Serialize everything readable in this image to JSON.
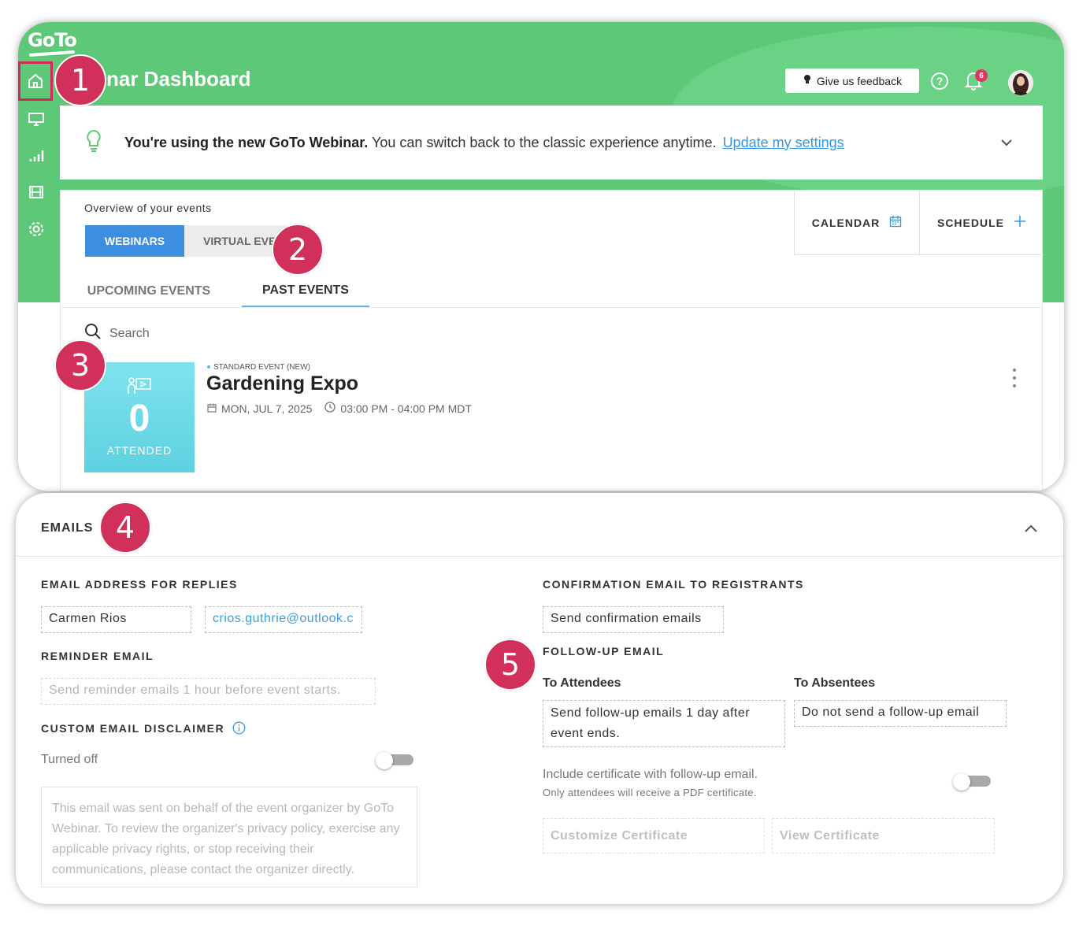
{
  "app": {
    "logo_text": "GoTo",
    "page_title": "nar Dashboard"
  },
  "header": {
    "feedback_label": "Give us feedback",
    "notification_count": "6"
  },
  "banner": {
    "bold_text": "You're using the new GoTo Webinar.",
    "text": " You can switch back to the classic experience anytime.",
    "link_text": "Update my settings"
  },
  "overview": {
    "label": "Overview of your events",
    "segments": [
      "WEBINARS",
      "VIRTUAL EVENTS"
    ],
    "calendar_label": "CALENDAR",
    "schedule_label": "SCHEDULE",
    "tabs": [
      "UPCOMING EVENTS",
      "PAST EVENTS"
    ],
    "search_placeholder": "Search"
  },
  "event": {
    "type": "STANDARD EVENT (NEW)",
    "title": "Gardening Expo",
    "date": "MON, JUL 7, 2025",
    "time": "03:00 PM - 04:00 PM MDT",
    "attended_count": "0",
    "attended_label": "ATTENDED"
  },
  "emails": {
    "header": "EMAILS",
    "reply_label": "EMAIL ADDRESS FOR REPLIES",
    "reply_name": "Carmen Rios",
    "reply_email": "crios.guthrie@outlook.c",
    "reminder_label": "REMINDER EMAIL",
    "reminder_value": "Send reminder emails 1 hour before event starts.",
    "disclaimer_label": "CUSTOM EMAIL DISCLAIMER",
    "disclaimer_state": "Turned off",
    "disclaimer_text": "This email was sent on behalf of the event organizer by GoTo Webinar. To review the organizer's privacy policy, exercise any applicable privacy rights, or stop receiving their communications, please contact the organizer directly.",
    "confirmation_label": "CONFIRMATION EMAIL TO REGISTRANTS",
    "confirmation_value": "Send confirmation emails",
    "followup_label": "FOLLOW-UP EMAIL",
    "attendees_label": "To Attendees",
    "attendees_value_line1": "Send follow-up emails 1 day after",
    "attendees_value_line2": "event ends.",
    "absentees_label": "To Absentees",
    "absentees_value": "Do not send a follow-up email",
    "certificate_label": "Include certificate with follow-up email.",
    "certificate_note": "Only attendees will receive a PDF certificate.",
    "customize_cert_label": "Customize Certificate",
    "view_cert_label": "View Certificate"
  },
  "callouts": [
    "1",
    "2",
    "3",
    "4",
    "5"
  ],
  "colors": {
    "brand_green": "#5cc878",
    "accent_blue": "#3c8fe0",
    "callout_red": "#d0305a",
    "attend_tile": "#6edae8"
  }
}
